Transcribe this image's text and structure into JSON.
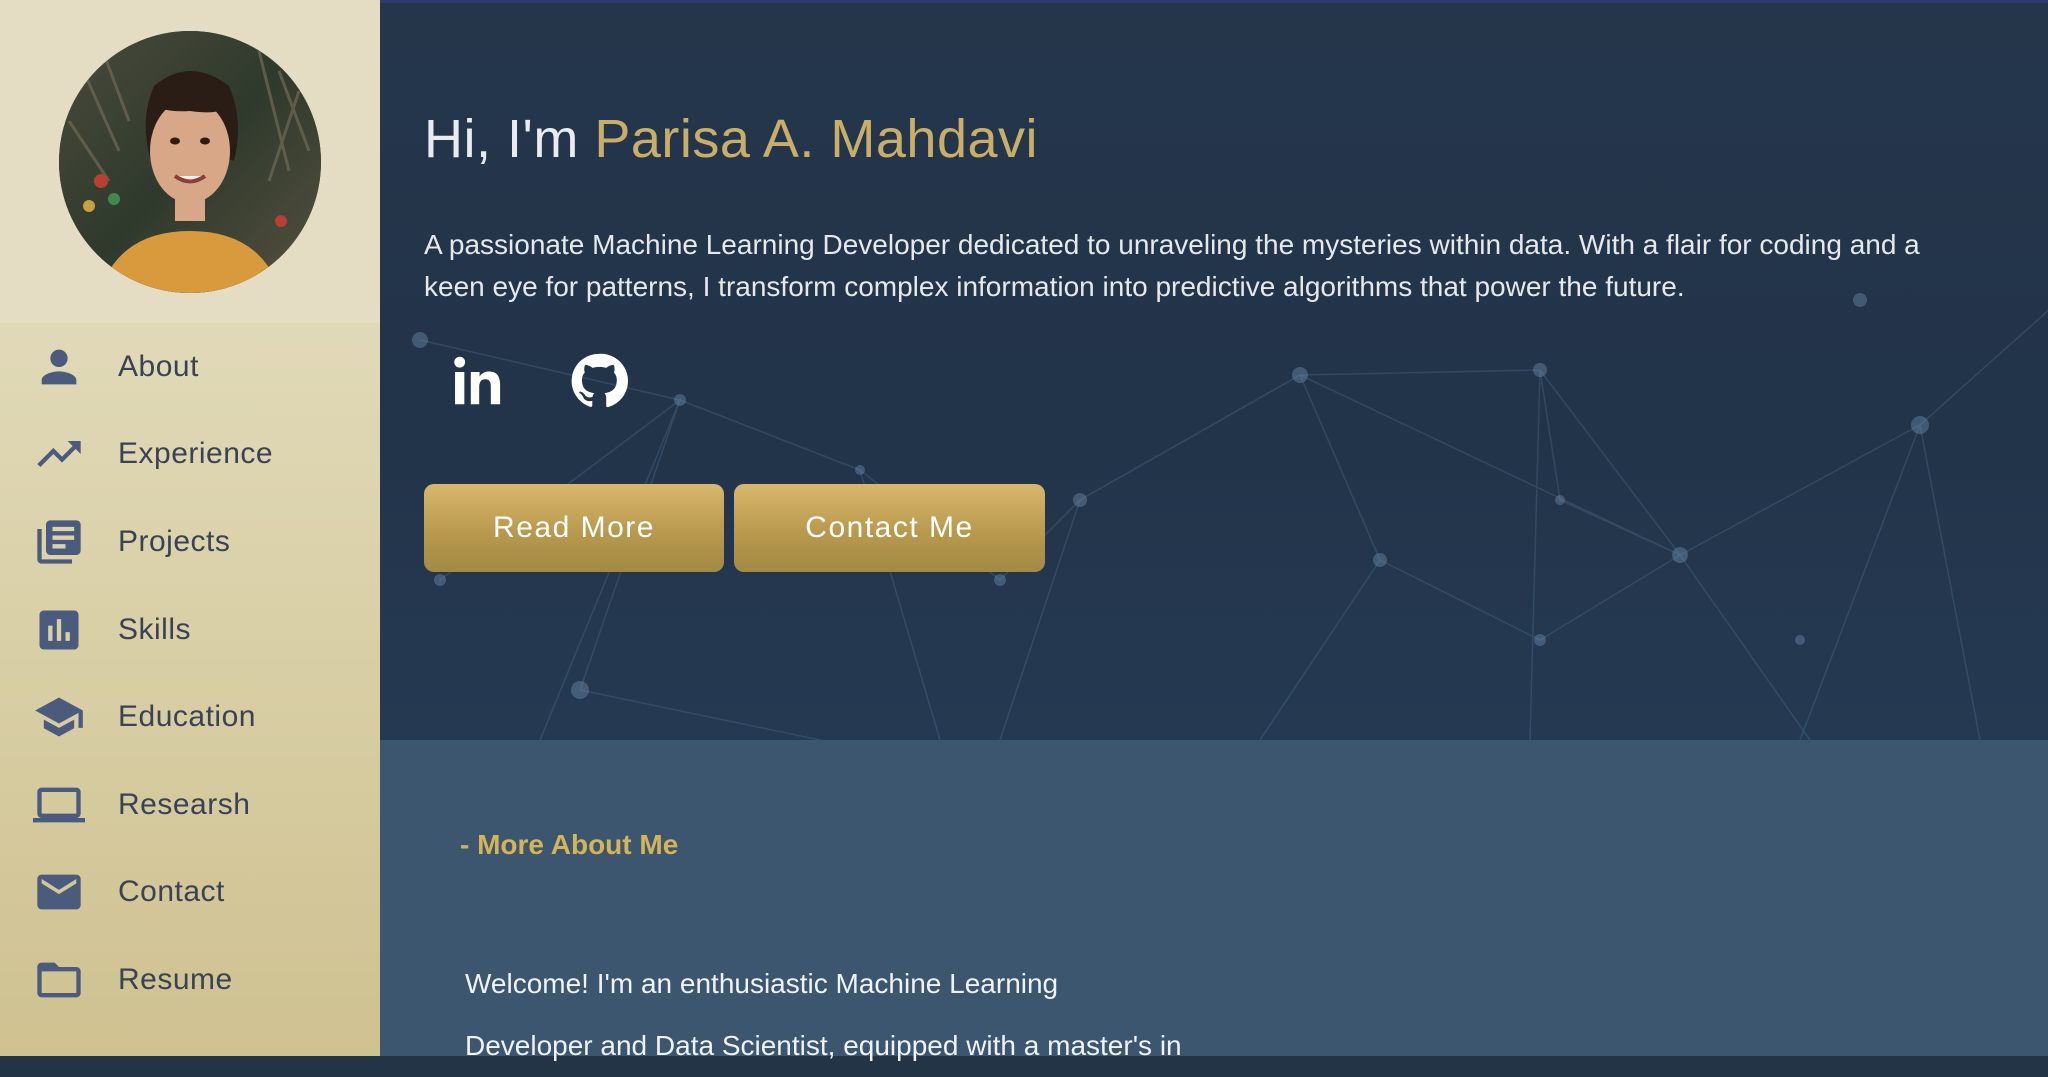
{
  "sidebar": {
    "avatar_alt": "Profile photo",
    "items": [
      {
        "label": "About",
        "icon": "person-icon"
      },
      {
        "label": "Experience",
        "icon": "trending-up-icon"
      },
      {
        "label": "Projects",
        "icon": "library-books-icon"
      },
      {
        "label": "Skills",
        "icon": "bar-chart-icon"
      },
      {
        "label": "Education",
        "icon": "school-icon"
      },
      {
        "label": "Researsh",
        "icon": "laptop-icon"
      },
      {
        "label": "Contact",
        "icon": "mail-icon"
      },
      {
        "label": "Resume",
        "icon": "folder-icon"
      }
    ]
  },
  "hero": {
    "greeting": "Hi, I'm",
    "name": "Parisa A. Mahdavi",
    "description": "A passionate Machine Learning Developer dedicated to unraveling the mysteries within data. With a flair for coding and a keen eye for patterns, I transform complex information into predictive algorithms that power the future.",
    "socials": [
      "linkedin-icon",
      "github-icon"
    ],
    "read_more_label": "Read More",
    "contact_label": "Contact Me"
  },
  "about": {
    "heading": "- More About Me",
    "line1": "Welcome! I'm an enthusiastic Machine Learning",
    "line2": "Developer and Data Scientist, equipped with a master's in"
  },
  "colors": {
    "accent_gold": "#c9ae68",
    "heading_gold": "#d4b457",
    "nav_icon": "#4a5b7d",
    "hero_bg": "#243447",
    "about_bg": "#3b566e"
  }
}
